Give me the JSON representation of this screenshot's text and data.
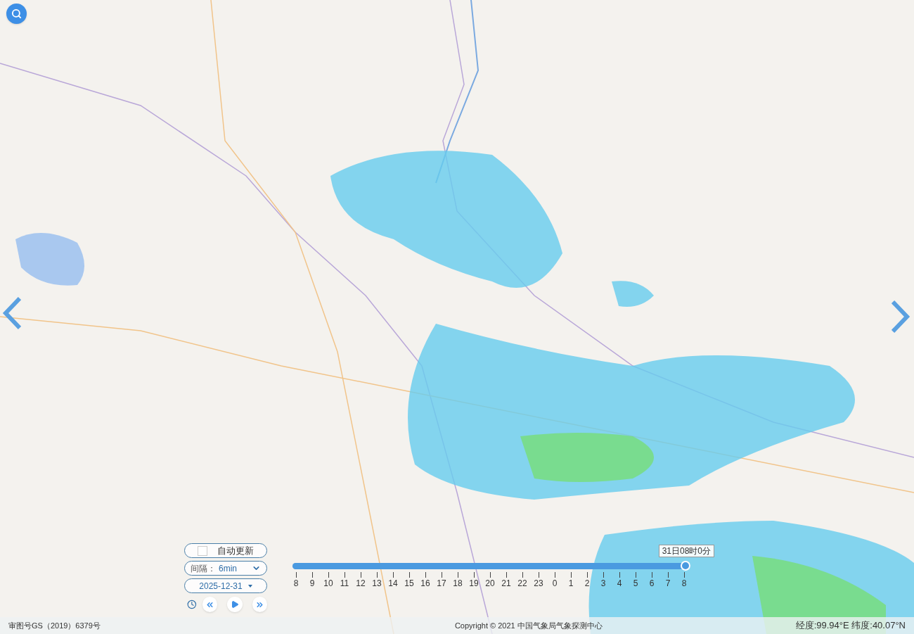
{
  "controls": {
    "auto_update": {
      "label": "自动更新",
      "checked": false
    },
    "interval": {
      "label": "间隔：",
      "value": "6min"
    },
    "date": {
      "value": "2025-12-31"
    }
  },
  "timeline": {
    "level": 1,
    "tooltip": "31日08时0分",
    "ticks": [
      "8",
      "9",
      "10",
      "11",
      "12",
      "13",
      "14",
      "15",
      "16",
      "17",
      "18",
      "19",
      "20",
      "21",
      "22",
      "23",
      "0",
      "1",
      "2",
      "3",
      "4",
      "5",
      "6",
      "7",
      "8"
    ]
  },
  "footer": {
    "approval": "审图号GS（2019）6379号",
    "copyright": "Copyright © 2021 中国气象局气象探测中心",
    "coordinates": "经度:99.94°E 纬度:40.07°N"
  }
}
